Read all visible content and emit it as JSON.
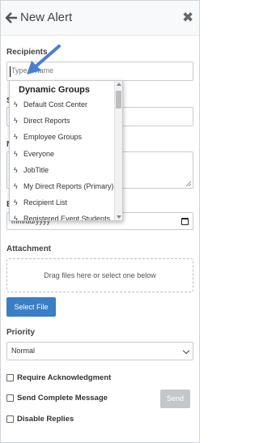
{
  "header": {
    "title": "New Alert"
  },
  "recipients": {
    "label": "Recipients",
    "placeholder": "Type a name"
  },
  "dropdown": {
    "heading": "Dynamic Groups",
    "items": [
      "Default Cost Center",
      "Direct Reports",
      "Employee Groups",
      "Everyone",
      "JobTitle",
      "My Direct Reports (Primary)",
      "Recipient List",
      "Registered Event Students"
    ]
  },
  "hidden_labels": {
    "subject_initial": "S",
    "message_initial": "N",
    "expiry_initial": "E"
  },
  "expiration": {
    "placeholder": "mm/dd/yyyy"
  },
  "attachment": {
    "label": "Attachment",
    "dropzone_text": "Drag files here or select one below",
    "select_button": "Select File"
  },
  "priority": {
    "label": "Priority",
    "selected": "Normal"
  },
  "options": {
    "require_ack": "Require Acknowledgment",
    "send_complete": "Send Complete Message",
    "disable_replies": "Disable Replies"
  },
  "send_button": "Send",
  "colors": {
    "primary": "#3a7ec4",
    "send_disabled": "#c4c7ca",
    "pointer_arrow": "#4a7fcc"
  }
}
